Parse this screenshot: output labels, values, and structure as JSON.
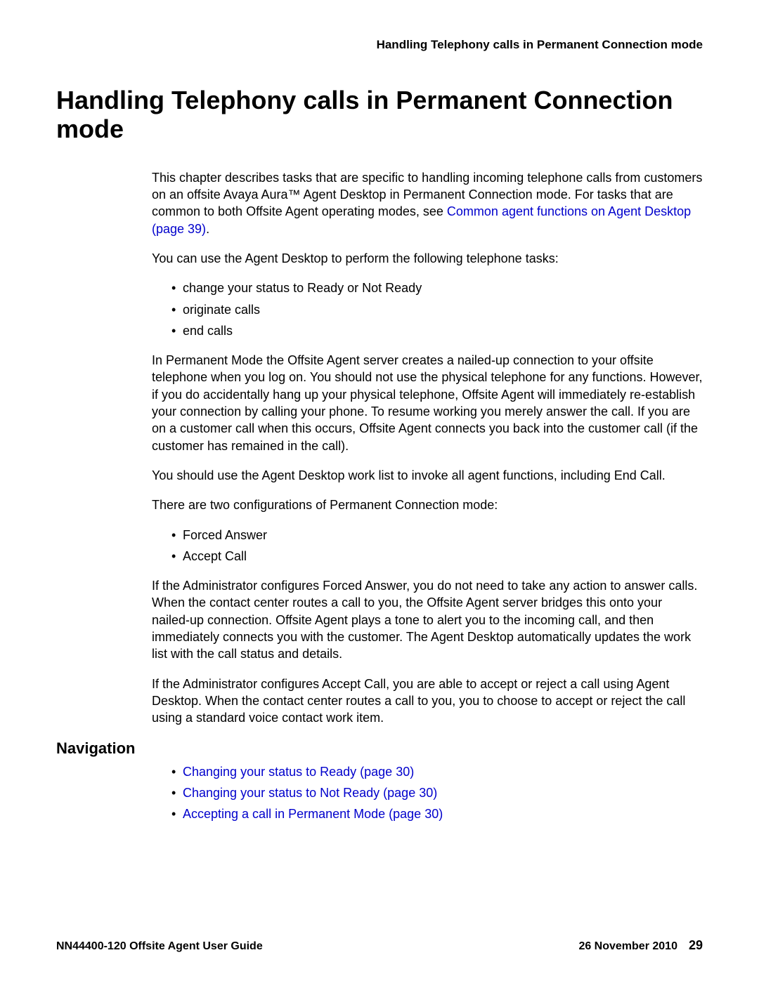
{
  "header": {
    "running": "Handling Telephony calls in Permanent Connection mode"
  },
  "title": "Handling Telephony calls in Permanent Connection mode",
  "intro": {
    "part1": "This chapter describes tasks that are specific to handling incoming telephone calls from customers on an offsite Avaya Aura™ Agent Desktop in Permanent Connection mode. For tasks that are common to both Offsite Agent operating modes, see ",
    "link_text": "Common agent functions on Agent Desktop (page 39)",
    "part2": "."
  },
  "para_tasks_lead": "You can use the Agent Desktop to perform the following telephone tasks:",
  "tasks": [
    "change your status to Ready or Not Ready",
    "originate calls",
    "end calls"
  ],
  "para_permanent_mode": "In Permanent Mode the Offsite Agent server creates a nailed-up connection to your offsite telephone when you log on. You should not use the physical telephone for any functions. However, if you do accidentally hang up your physical telephone, Offsite Agent will immediately re-establish your connection by calling your phone. To resume working you merely answer the call. If you are on a customer call when this occurs, Offsite Agent connects you back into the customer call (if the customer has remained in the call).",
  "para_worklist": "You should use the Agent Desktop work list to invoke all agent functions, including End Call.",
  "para_configs_lead": "There are two configurations of Permanent Connection mode:",
  "configs": [
    "Forced Answer",
    "Accept Call"
  ],
  "para_forced": "If the Administrator configures Forced Answer, you do not need to take any action to answer calls. When the contact center routes a call to you, the Offsite Agent server bridges this onto your nailed-up connection. Offsite Agent plays a tone to alert you to the incoming call, and then immediately connects you with the customer. The Agent Desktop automatically updates the work list with the call status and details.",
  "para_accept": "If the Administrator configures Accept Call, you are able to accept or reject a call using Agent Desktop. When the contact center routes a call to you, you to choose to accept or reject the call using a standard voice contact work item.",
  "nav_heading": "Navigation",
  "nav_links": [
    "Changing your status to Ready (page 30)",
    "Changing your status to Not Ready (page 30)",
    "Accepting a call in Permanent Mode (page 30)"
  ],
  "footer": {
    "left": "NN44400-120 Offsite Agent User Guide",
    "date": "26 November 2010",
    "page": "29"
  }
}
